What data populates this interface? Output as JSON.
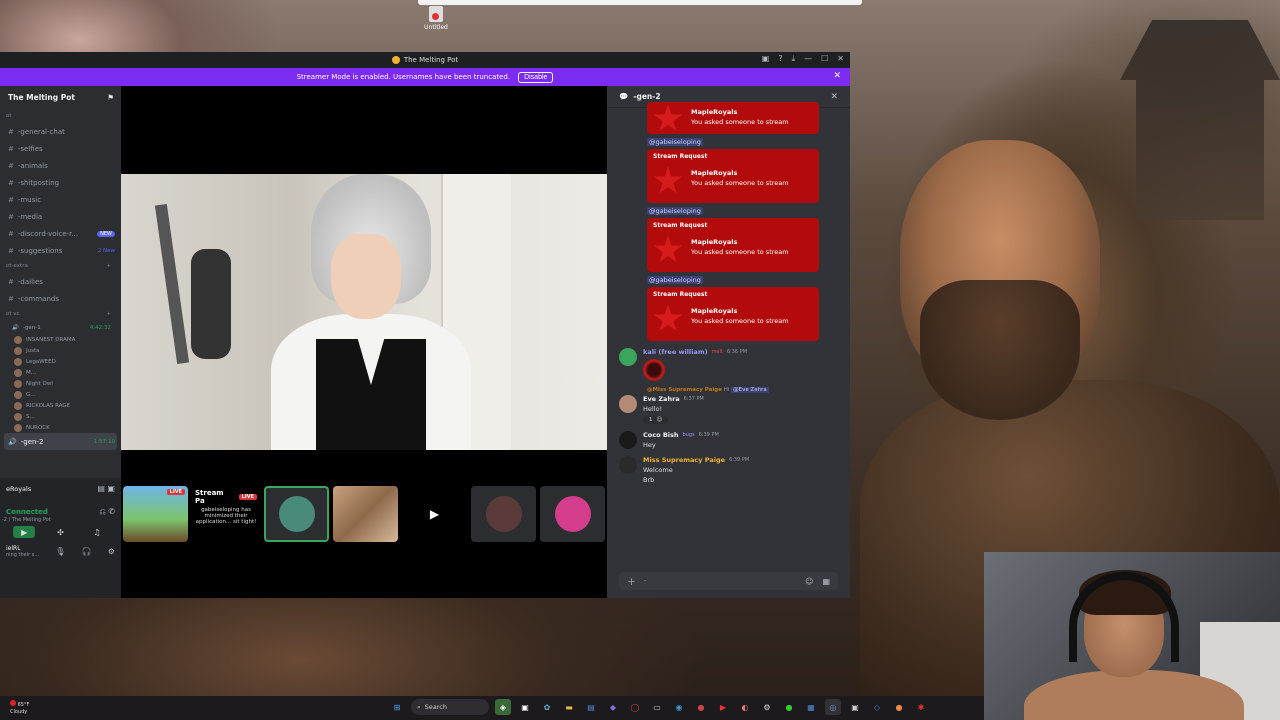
{
  "desktop": {
    "untitled_icon_label": "Untitled"
  },
  "window": {
    "title": "The Melting Pot",
    "banner_text": "Streamer Mode is enabled. Usernames have been truncated.",
    "banner_button": "Disable"
  },
  "sidebar": {
    "guild_name": "The Melting Pot",
    "channels": [
      {
        "label": "-general-chat",
        "icon": "✨"
      },
      {
        "label": "-selfies",
        "icon": "📸"
      },
      {
        "label": "-animals",
        "icon": "🐾"
      },
      {
        "label": "-shitposting",
        "icon": "💩"
      },
      {
        "label": "-music",
        "icon": "🎵"
      },
      {
        "label": "-media",
        "icon": "📺"
      },
      {
        "label": "-discord-voice-r...",
        "icon": "🎤",
        "badge": "NEW"
      },
      {
        "label": "-suggestions",
        "icon": "💡",
        "new_count": "2 New"
      }
    ],
    "category2": "ot-extra",
    "channels2": [
      {
        "label": "-dailies",
        "icon": "📅"
      },
      {
        "label": "-commands",
        "icon": "⌨"
      }
    ],
    "category3": "ot vc",
    "voice_channel": {
      "label": "-gen-1",
      "time": "4:42:32"
    },
    "voice_users": [
      "INSANEST DRAMA",
      "Justa",
      "LegaWEED",
      "M...",
      "Night Owl",
      "G...",
      "RICKOLAS RAGE",
      "S...",
      "NUROCK"
    ],
    "active_channel": {
      "label": "-gen-2",
      "time": "1:57:10"
    },
    "panel": {
      "stream_name": "eRoyals",
      "connected": "Connected",
      "connected_sub": "-2 / The Melting Pot",
      "user_name": "ielRL",
      "user_status": "ning their s..."
    }
  },
  "stage": {
    "thumbs": [
      {
        "type": "game",
        "live": "LIVE"
      },
      {
        "type": "info",
        "title": "Stream Pa",
        "live": "LIVE",
        "desc": "gabeiseloping has minimized their application... sit tight!"
      },
      {
        "type": "avatar",
        "color": "#4a8a7a"
      },
      {
        "type": "collage"
      },
      {
        "type": "cam",
        "icon": "camera-icon"
      },
      {
        "type": "avatar",
        "color": "#5b3a3a"
      },
      {
        "type": "avatar",
        "color": "#d43c8c"
      }
    ]
  },
  "thread": {
    "title": "-gen-2",
    "mention": "@gabeiseloping",
    "stream_label": "Stream Request",
    "stream_name": "MapleRoyals",
    "stream_sub": "You asked someone to stream",
    "messages": [
      {
        "author": "kali (free william)",
        "tag": "melt",
        "time": "6:36 PM",
        "color": "#3ba55c"
      },
      {
        "reply_author": "@Miss Supremacy Paige",
        "reply_text": "Hi",
        "reply_mention": "@Eve Zahra",
        "author": "Eve Zahra",
        "time": "6:37 PM",
        "text": "Hello!",
        "reaction": "1"
      },
      {
        "author": "Coco Bish",
        "tag": "bugs",
        "time": "6:39 PM",
        "text": "Hey"
      },
      {
        "author": "Miss Supremacy Paige",
        "time": "6:39 PM",
        "text": "Welcome",
        "text2": "Brb"
      }
    ]
  },
  "taskbar": {
    "temp": "65°F",
    "weather": "Cloudy",
    "search_placeholder": "Search"
  }
}
